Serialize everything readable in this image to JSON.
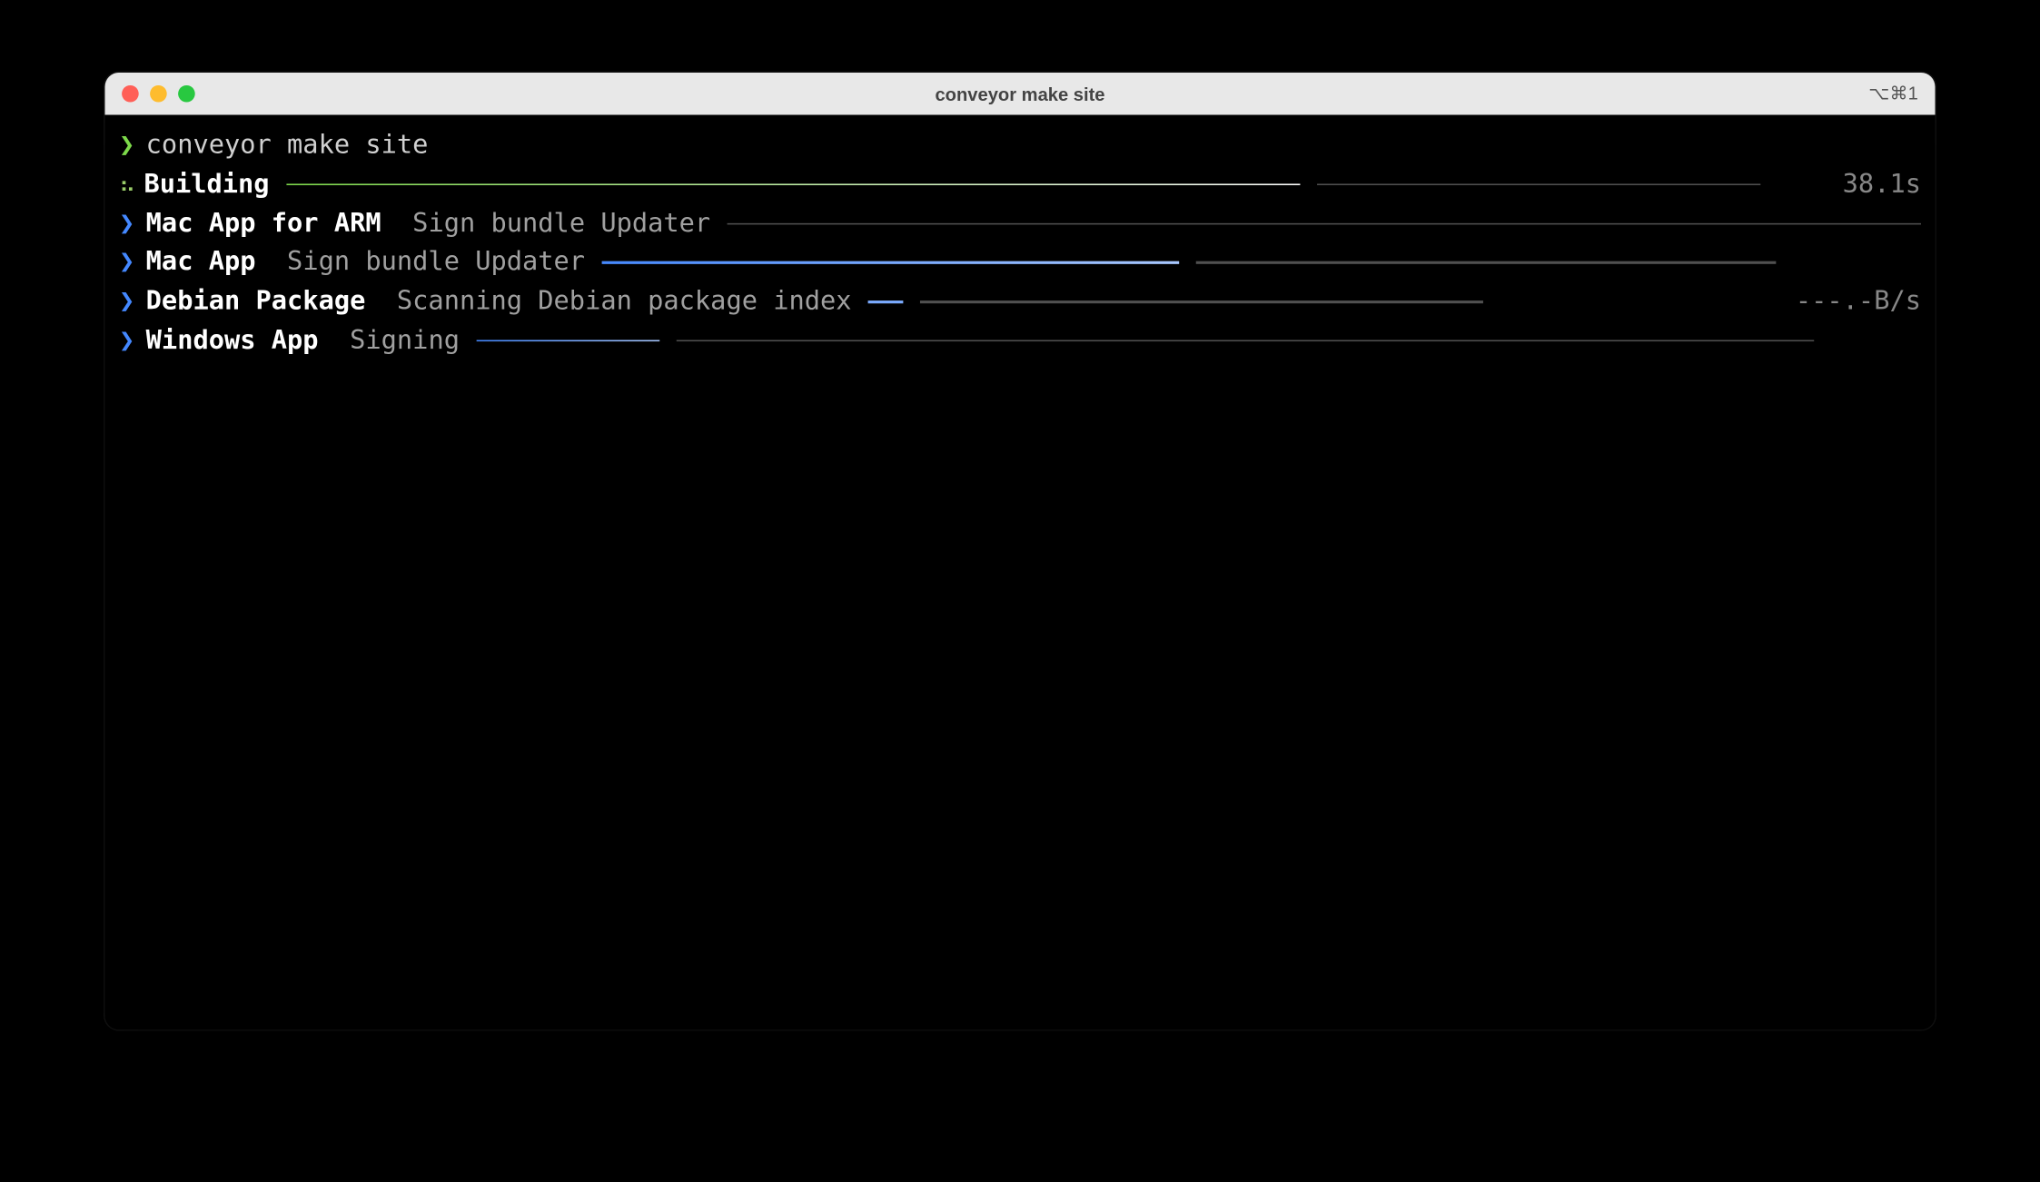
{
  "window": {
    "title": "conveyor make site",
    "shortcut": "⌥⌘1"
  },
  "prompt": {
    "chevron": "❯",
    "command": "conveyor make site"
  },
  "building": {
    "spinner": "⠦",
    "label": "Building",
    "time": "38.1s",
    "bar1_pct": 100,
    "bar2_pct": 0,
    "bar1_w": 720,
    "bar2_w": 315
  },
  "tasks": [
    {
      "chevron": "❯",
      "name": "Mac App for ARM",
      "status": "Sign bundle Updater",
      "right": "",
      "bar1_pct": 0,
      "bar2_pct": 0,
      "bar1_w": 720,
      "bar2_w": 0,
      "col1": "col-mac-arm-1",
      "col2": "col-mac-arm-2"
    },
    {
      "chevron": "❯",
      "name": "Mac App",
      "status": "Sign bundle Updater",
      "right": "",
      "bar1_pct": 100,
      "bar2_pct": 0,
      "bar1_w": 410,
      "bar2_w": 412,
      "col1": "col-mac-1",
      "col2": "col-mac-2"
    },
    {
      "chevron": "❯",
      "name": "Debian Package",
      "status": "Scanning Debian package index",
      "right": "---.-B/s",
      "bar1_pct": 100,
      "bar2_pct": 0,
      "bar1_w": 25,
      "bar2_w": 400,
      "col1": "col-deb-1",
      "col2": "col-deb-2"
    },
    {
      "chevron": "❯",
      "name": "Windows App",
      "status": "Signing",
      "right": "",
      "bar1_pct": 100,
      "bar2_pct": 0,
      "bar1_w": 130,
      "bar2_w": 808,
      "col1": "col-win-1",
      "col2": "col-win-2"
    }
  ]
}
